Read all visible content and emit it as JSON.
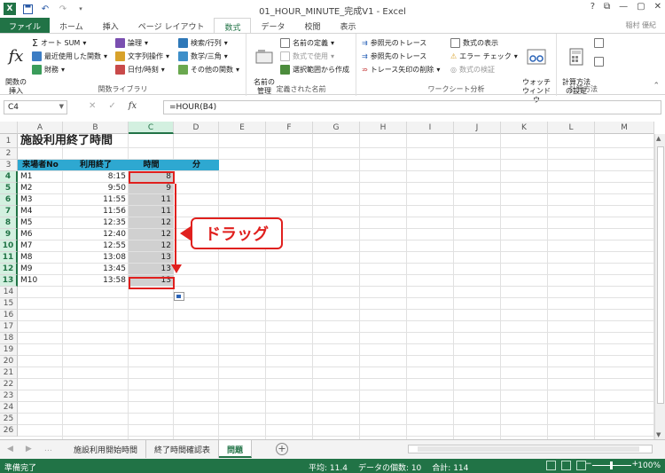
{
  "window": {
    "title": "01_HOUR_MINUTE_完成V1 - Excel",
    "user": "稲村 優紀",
    "help": "?",
    "restore": "⧉",
    "minimize": "—",
    "maximize": "▢",
    "close": "✕"
  },
  "tabs": [
    "ファイル",
    "ホーム",
    "挿入",
    "ページ レイアウト",
    "数式",
    "データ",
    "校閲",
    "表示"
  ],
  "ribbon": {
    "function_library": {
      "insert_function": "関数の\n挿入",
      "autosum": "オート SUM",
      "recent": "最近使用した関数",
      "financial": "財務",
      "logical": "論理",
      "text": "文字列操作",
      "datetime": "日付/時刻",
      "lookup": "検索/行列",
      "math": "数学/三角",
      "more": "その他の関数",
      "label": "関数ライブラリ"
    },
    "defined_names": {
      "name_manager": "名前の\n管理",
      "define_name": "名前の定義",
      "use_in_formula": "数式で使用",
      "create_from_selection": "選択範囲から作成",
      "label": "定義された名前"
    },
    "formula_auditing": {
      "trace_precedents": "参照元のトレース",
      "trace_dependents": "参照先のトレース",
      "remove_arrows": "トレース矢印の削除",
      "show_formulas": "数式の表示",
      "error_checking": "エラー チェック",
      "evaluate_formula": "数式の検証",
      "watch_window": "ウォッチ\nウィンドウ",
      "label": "ワークシート分析"
    },
    "calculation": {
      "options": "計算方法\nの設定",
      "label": "計算方法"
    }
  },
  "formula_bar": {
    "name_box": "C4",
    "cancel": "✕",
    "enter": "✓",
    "fx": "fx",
    "formula": "=HOUR(B4)"
  },
  "columns": [
    "A",
    "B",
    "C",
    "D",
    "E",
    "F",
    "G",
    "H",
    "I",
    "J",
    "K",
    "L",
    "M"
  ],
  "rows": [
    "1",
    "2",
    "3",
    "4",
    "5",
    "6",
    "7",
    "8",
    "9",
    "10",
    "11",
    "12",
    "13",
    "14",
    "15",
    "16",
    "17",
    "18",
    "19",
    "20",
    "21",
    "22",
    "23",
    "24",
    "25",
    "26"
  ],
  "sheet": {
    "title": "施設利用終了時間",
    "headers": [
      "来場者No",
      "利用終了",
      "時間",
      "分"
    ],
    "data": [
      {
        "no": "M1",
        "end": "8:15",
        "hour": "8"
      },
      {
        "no": "M2",
        "end": "9:50",
        "hour": "9"
      },
      {
        "no": "M3",
        "end": "11:55",
        "hour": "11"
      },
      {
        "no": "M4",
        "end": "11:56",
        "hour": "11"
      },
      {
        "no": "M5",
        "end": "12:35",
        "hour": "12"
      },
      {
        "no": "M6",
        "end": "12:40",
        "hour": "12"
      },
      {
        "no": "M7",
        "end": "12:55",
        "hour": "12"
      },
      {
        "no": "M8",
        "end": "13:08",
        "hour": "13"
      },
      {
        "no": "M9",
        "end": "13:45",
        "hour": "13"
      },
      {
        "no": "M10",
        "end": "13:58",
        "hour": "13"
      }
    ]
  },
  "annotation": {
    "callout": "ドラッグ"
  },
  "sheet_tabs": [
    "施設利用開始時間",
    "終了時間確認表",
    "問題"
  ],
  "add_sheet": "+",
  "nav": {
    "prev": "◀",
    "next": "▶",
    "more": "…"
  },
  "status": {
    "ready": "準備完了",
    "average": "平均: 11.4",
    "count": "データの個数: 10",
    "sum": "合計: 114",
    "zoom": "100%",
    "zoom_minus": "−",
    "zoom_plus": "+"
  },
  "colors": {
    "excel_green": "#217346",
    "header_fill": "#2ea8d1",
    "annotation_red": "#e0201e"
  }
}
